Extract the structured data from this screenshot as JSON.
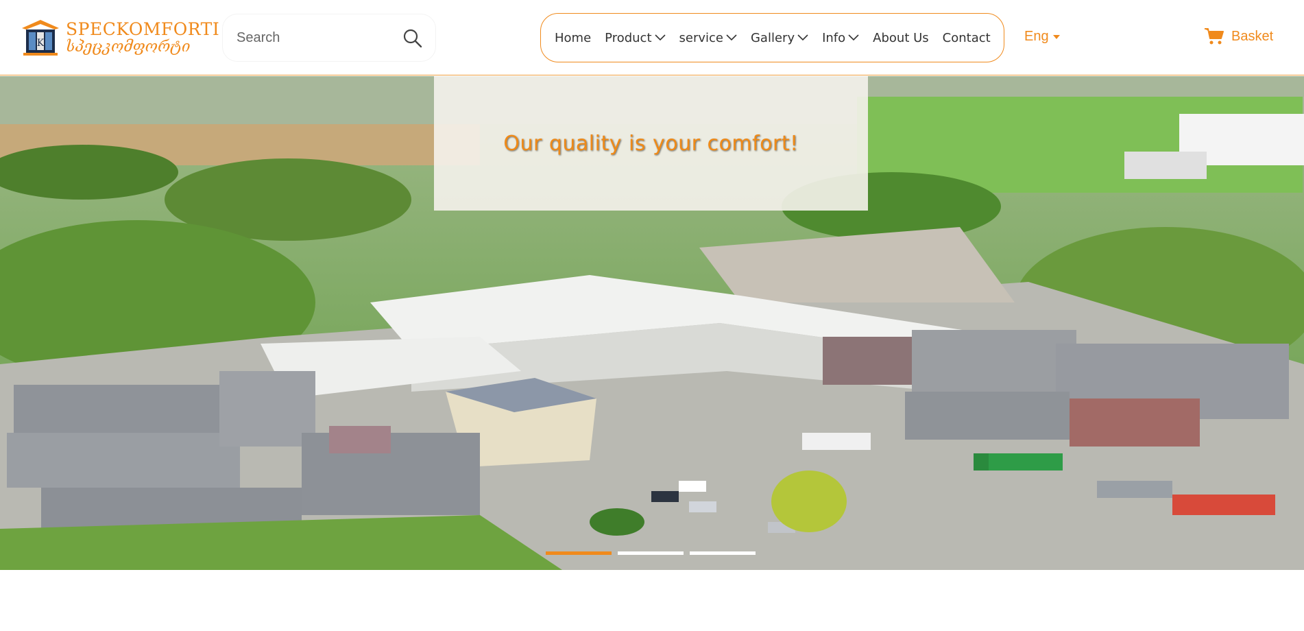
{
  "header": {
    "logo": {
      "line1": "SPECKOMFORTI",
      "line2": "სპეცკომფორტი"
    },
    "search": {
      "placeholder": "Search",
      "icon": "search-icon"
    },
    "nav": {
      "items": [
        {
          "label": "Home",
          "dropdown": false
        },
        {
          "label": "Product",
          "dropdown": true
        },
        {
          "label": "service",
          "dropdown": true
        },
        {
          "label": "Gallery",
          "dropdown": true
        },
        {
          "label": "Info",
          "dropdown": true
        },
        {
          "label": "About Us",
          "dropdown": false
        },
        {
          "label": "Contact",
          "dropdown": false
        }
      ]
    },
    "language": {
      "label": "Eng"
    },
    "basket": {
      "label": "Basket",
      "icon": "cart-icon"
    }
  },
  "hero": {
    "tagline": "Our quality is your comfort!",
    "slides": [
      {
        "active": true
      },
      {
        "active": false
      },
      {
        "active": false
      }
    ]
  },
  "colors": {
    "accent": "#f08a1c",
    "nav_text": "#333333"
  }
}
